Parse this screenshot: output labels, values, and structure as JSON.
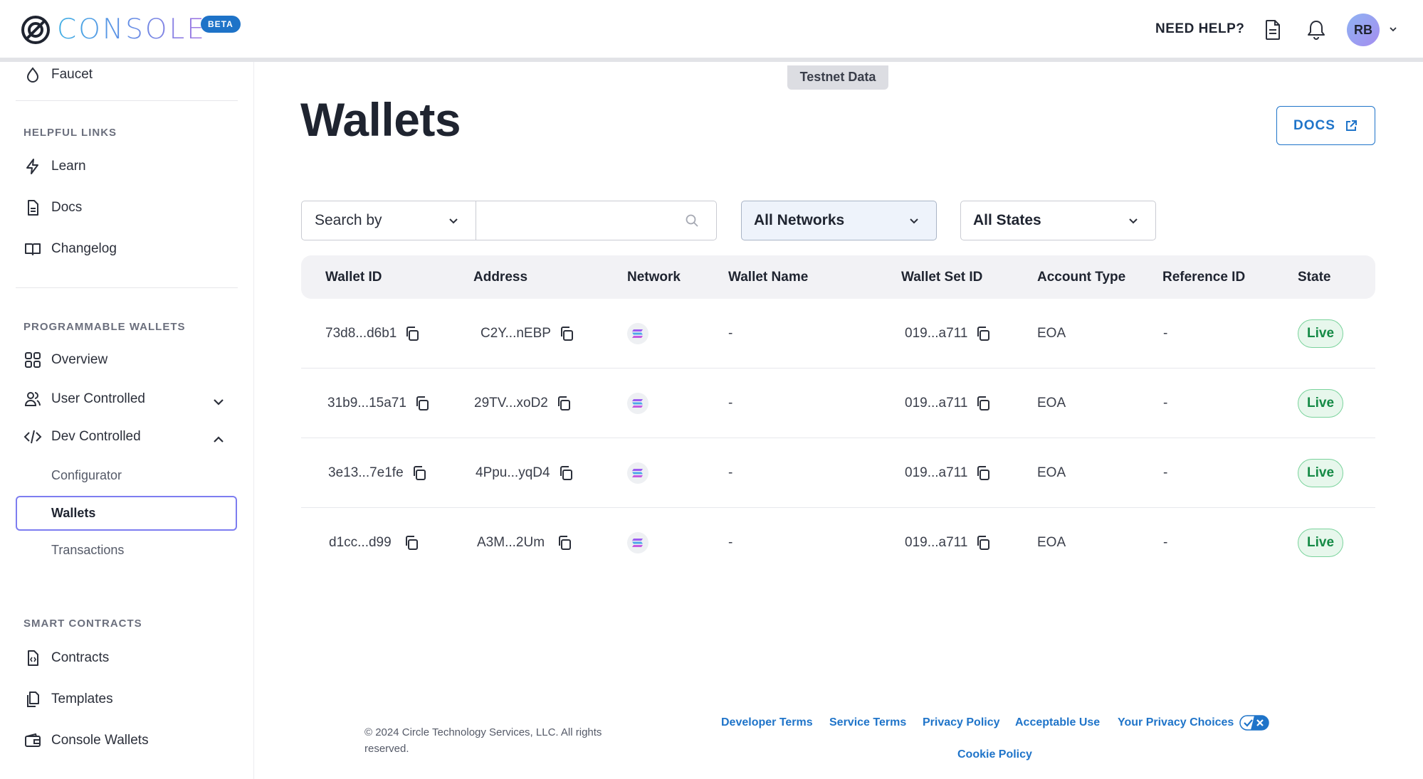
{
  "header": {
    "logo_text": "CONSOLE",
    "beta_badge": "BETA",
    "help_label": "NEED HELP?",
    "avatar_initials": "RB"
  },
  "sidebar": {
    "top_item": "Faucet",
    "helpful_links_title": "HELPFUL LINKS",
    "helpful_links": [
      "Learn",
      "Docs",
      "Changelog"
    ],
    "programmable_title": "PROGRAMMABLE WALLETS",
    "overview": "Overview",
    "user_controlled": "User Controlled",
    "dev_controlled": "Dev Controlled",
    "dev_sub": [
      "Configurator",
      "Wallets",
      "Transactions"
    ],
    "smart_contracts_title": "SMART CONTRACTS",
    "smart_contracts": [
      "Contracts",
      "Templates",
      "Console Wallets"
    ]
  },
  "main": {
    "env_tab": "Testnet Data",
    "title": "Wallets",
    "docs_button": "DOCS",
    "search_by": "Search by",
    "search_placeholder": "",
    "network_filter": "All Networks",
    "state_filter": "All States"
  },
  "table": {
    "columns": [
      "Wallet ID",
      "Address",
      "Network",
      "Wallet Name",
      "Wallet Set ID",
      "Account Type",
      "Reference ID",
      "State"
    ],
    "rows": [
      {
        "wallet_id": "73d8...d6b1",
        "address": "C2Y...nEBP",
        "network": "solana-icon",
        "wallet_name": "-",
        "wallet_set_id": "019...a711",
        "account_type": "EOA",
        "reference_id": "-",
        "state": "Live"
      },
      {
        "wallet_id": "31b9...15a71",
        "address": "29TV...xoD2",
        "network": "solana-icon",
        "wallet_name": "-",
        "wallet_set_id": "019...a711",
        "account_type": "EOA",
        "reference_id": "-",
        "state": "Live"
      },
      {
        "wallet_id": "3e13...7e1fe",
        "address": "4Ppu...yqD4",
        "network": "solana-icon",
        "wallet_name": "-",
        "wallet_set_id": "019...a711",
        "account_type": "EOA",
        "reference_id": "-",
        "state": "Live"
      },
      {
        "wallet_id": "d1cc...d99",
        "address": "A3M...2Um",
        "network": "solana-icon",
        "wallet_name": "-",
        "wallet_set_id": "019...a711",
        "account_type": "EOA",
        "reference_id": "-",
        "state": "Live"
      }
    ]
  },
  "footer": {
    "copyright": "© 2024 Circle Technology Services, LLC. All rights reserved.",
    "links": [
      "Developer Terms",
      "Service Terms",
      "Privacy Policy",
      "Acceptable Use",
      "Your Privacy Choices",
      "Cookie Policy"
    ]
  },
  "colors": {
    "accent": "#1f74c9",
    "live_green": "#148a45",
    "active_outline": "#7d7df0"
  }
}
